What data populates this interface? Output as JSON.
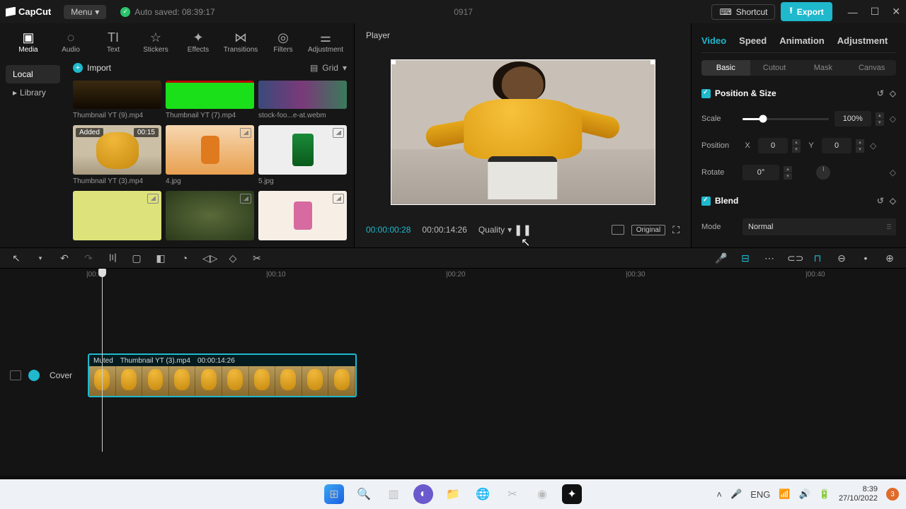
{
  "app": {
    "name": "CapCut",
    "menu": "Menu",
    "autosave": "Auto saved: 08:39:17",
    "project": "0917"
  },
  "titlebar": {
    "shortcut": "Shortcut",
    "export": "Export"
  },
  "media": {
    "tabs": [
      "Media",
      "Audio",
      "Text",
      "Stickers",
      "Effects",
      "Transitions",
      "Filters",
      "Adjustment"
    ],
    "side": {
      "local": "Local",
      "library": "Library"
    },
    "import": "Import",
    "grid_label": "Grid",
    "items": [
      {
        "name": "Thumbnail YT (9).mp4"
      },
      {
        "name": "Thumbnail YT (7).mp4"
      },
      {
        "name": "stock-foo...e-at.webm"
      },
      {
        "name": "Thumbnail YT (3).mp4",
        "badge": "Added",
        "dur": "00:15"
      },
      {
        "name": "4.jpg"
      },
      {
        "name": "5.jpg"
      }
    ]
  },
  "player": {
    "title": "Player",
    "time_current": "00:00:00:28",
    "time_duration": "00:00:14:26",
    "quality": "Quality",
    "original": "Original"
  },
  "inspector": {
    "tabs": [
      "Video",
      "Speed",
      "Animation",
      "Adjustment"
    ],
    "subtabs": [
      "Basic",
      "Cutout",
      "Mask",
      "Canvas"
    ],
    "section_pos": "Position & Size",
    "scale_label": "Scale",
    "scale_value": "100%",
    "position_label": "Position",
    "x": "X",
    "x_val": "0",
    "y": "Y",
    "y_val": "0",
    "rotate_label": "Rotate",
    "rotate_val": "0°",
    "section_blend": "Blend",
    "mode_label": "Mode",
    "mode_value": "Normal"
  },
  "ruler": {
    "t0": "|00:00",
    "t1": "|00:10",
    "t2": "|00:20",
    "t3": "|00:30",
    "t4": "|00:40"
  },
  "timeline": {
    "cover": "Cover",
    "clip": {
      "muted": "Muted",
      "name": "Thumbnail YT (3).mp4",
      "dur": "00:00:14:26"
    }
  },
  "taskbar": {
    "time": "8:39",
    "date": "27/10/2022",
    "notif": "3"
  }
}
